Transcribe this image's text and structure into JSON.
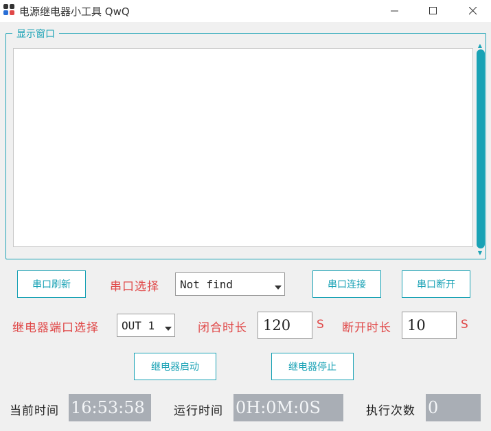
{
  "window": {
    "title": "电源继电器小工具 QwQ",
    "controls": [
      "minimize",
      "maximize",
      "close"
    ]
  },
  "display_group": {
    "title": "显示窗口",
    "content": ""
  },
  "serial": {
    "refresh_label": "串口刷新",
    "select_label": "串口选择",
    "port_value": "Not find",
    "connect_label": "串口连接",
    "disconnect_label": "串口断开"
  },
  "relay": {
    "port_label": "继电器端口选择",
    "port_value": "OUT 1",
    "close_duration_label": "闭合时长",
    "close_duration_value": "120",
    "close_duration_unit": "S",
    "open_duration_label": "断开时长",
    "open_duration_value": "10",
    "open_duration_unit": "S",
    "start_label": "继电器启动",
    "stop_label": "继电器停止"
  },
  "status": {
    "current_time_label": "当前时间",
    "current_time_value": "16:53:58",
    "run_time_label": "运行时间",
    "run_time_value": "0H:0M:0S",
    "exec_count_label": "执行次数",
    "exec_count_value": "0"
  },
  "colors": {
    "accent": "#19a2b5",
    "label_red": "#e04848",
    "display_bg": "#a9aeb5"
  }
}
